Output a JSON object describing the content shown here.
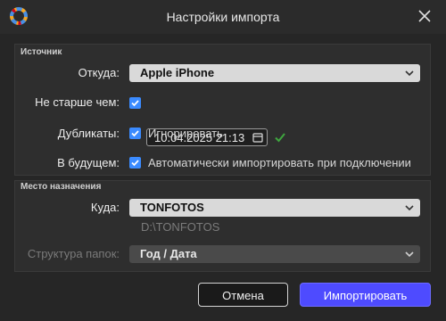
{
  "window": {
    "title": "Настройки импорта",
    "app_icon": "colorful-ring-logo-icon",
    "close_icon": "close-icon"
  },
  "source": {
    "section_title": "Источник",
    "from_label": "Откуда:",
    "from_value": "Apple iPhone",
    "older_label": "Не старше чем:",
    "older_checked": true,
    "date_value": "10.04.2025 21:13",
    "duplicates_label": "Дубликаты:",
    "duplicates_checked": true,
    "duplicates_option": "Игнорировать",
    "future_label": "В будущем:",
    "future_checked": true,
    "future_option": "Автоматически импортировать при подключении"
  },
  "destination": {
    "section_title": "Место назначения",
    "to_label": "Куда:",
    "to_value": "TONFOTOS",
    "path": "D:\\TONFOTOS",
    "structure_label": "Структура папок:",
    "structure_value": "Год / Дата"
  },
  "buttons": {
    "cancel": "Отмена",
    "import": "Импортировать"
  },
  "colors": {
    "accent": "#4e4bff",
    "checkbox": "#3b8bff",
    "valid_check": "#3fa63f"
  }
}
